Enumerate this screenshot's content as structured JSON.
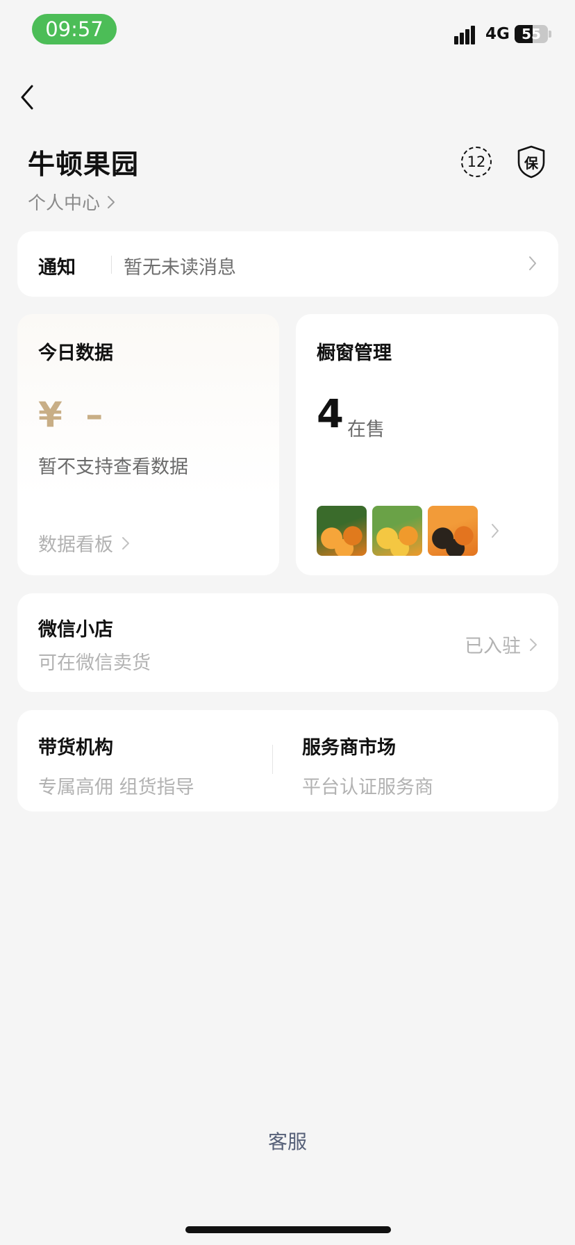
{
  "status_bar": {
    "time": "09:57",
    "network": "4G",
    "battery": "55",
    "battery_level": 0.55
  },
  "header": {
    "shop_name": "牛顿果园",
    "profile_link": "个人中心",
    "badge_count": "12",
    "guarantee_label": "保"
  },
  "notice": {
    "label": "通知",
    "message": "暂无未读消息"
  },
  "today_data": {
    "title": "今日数据",
    "amount": "¥ –",
    "unsupported": "暂不支持查看数据",
    "dashboard_link": "数据看板"
  },
  "showcase": {
    "title": "橱窗管理",
    "count": "4",
    "count_unit": "在售",
    "thumbnails": [
      {
        "caption": "",
        "colors": [
          "#f6a53a",
          "#e07a1d",
          "#3a6b2b"
        ]
      },
      {
        "caption": "",
        "colors": [
          "#f4c742",
          "#f09a2c",
          "#6aa247"
        ]
      },
      {
        "caption": "",
        "colors": [
          "#2a231c",
          "#e3741f",
          "#f29b39"
        ]
      }
    ]
  },
  "wechat_store": {
    "title": "微信小店",
    "subtitle": "可在微信卖货",
    "status": "已入驻"
  },
  "services": [
    {
      "title": "带货机构",
      "subtitle": "专属高佣 组货指导"
    },
    {
      "title": "服务商市场",
      "subtitle": "平台认证服务商"
    }
  ],
  "footer": {
    "customer_service": "客服"
  },
  "colors": {
    "background": "#f5f5f5",
    "status_pill": "#4cbd57",
    "amount": "#c8ae86",
    "link": "#566078"
  }
}
